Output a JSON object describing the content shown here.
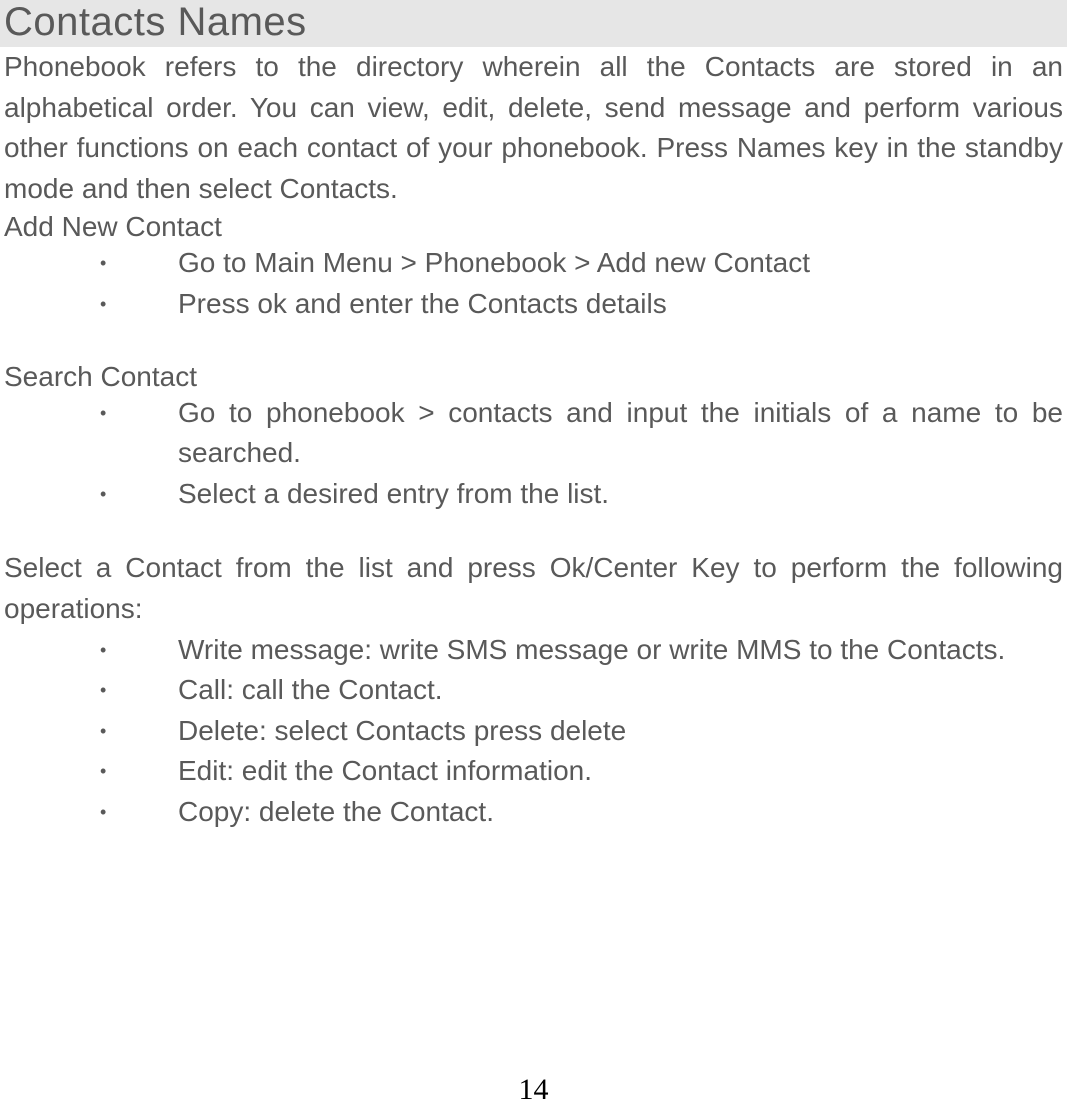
{
  "title": "Contacts Names",
  "intro": "Phonebook refers to the directory wherein all the Contacts are stored in an alphabetical order. You can view, edit, delete, send message and perform various other functions on each contact of your phonebook. Press Names  key in the standby mode and then select Contacts.",
  "sections": {
    "addNew": {
      "heading": "Add New Contact",
      "items": [
        "Go to Main Menu > Phonebook > Add new Contact",
        "Press ok and enter the Contacts details"
      ]
    },
    "search": {
      "heading": "Search Contact",
      "items": [
        "Go to phonebook > contacts and input the initials of a name to be searched.",
        "Select a desired entry from the list."
      ]
    },
    "operationsIntro": "Select a Contact from the list and press Ok/Center Key to perform the following operations:",
    "operations": [
      {
        "label": "Write message:",
        "text": " write SMS message or write MMS  to the Contacts."
      },
      {
        "label": "Call:",
        "text": " call the Contact."
      },
      {
        "label": "Delete:",
        "text": "  select Contacts press delete"
      },
      {
        "label": "Edit:",
        "text": " edit the Contact information."
      },
      {
        "label": "Copy:",
        "text": " delete the Contact."
      }
    ]
  },
  "pageNumber": "14"
}
